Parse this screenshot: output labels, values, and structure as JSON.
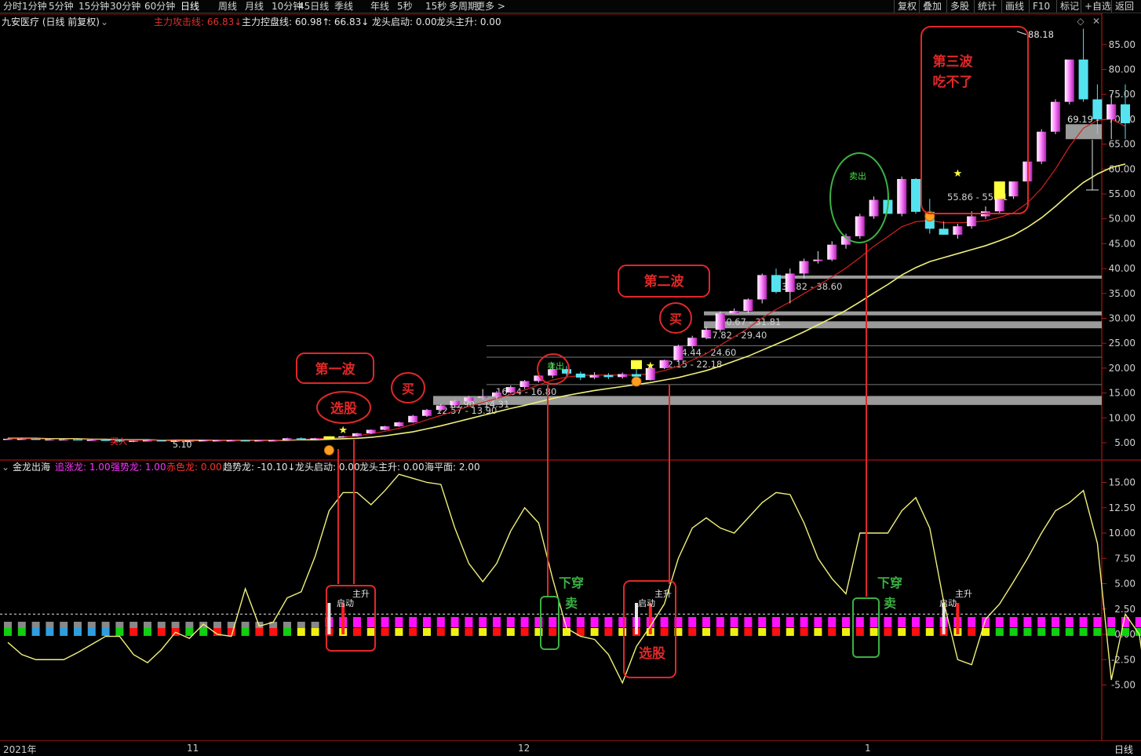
{
  "toolbar": {
    "left": [
      "分时",
      "1分钟",
      "5分钟",
      "15分钟",
      "30分钟",
      "60分钟",
      "日线",
      "周线",
      "月线",
      "10分钟",
      "45日线",
      "季线",
      "年线",
      "5秒",
      "15秒",
      "多周期",
      "更多 >"
    ],
    "active_index": 6,
    "right": [
      "复权",
      "叠加",
      "多股",
      "统计",
      "画线",
      "F10",
      "标记",
      "+自选",
      "返回"
    ]
  },
  "main_panel": {
    "stock": "九安医疗 (日线 前复权)",
    "legend": [
      {
        "text": "主力攻击线: 66.83↓",
        "color": "#e03030"
      },
      {
        "text": "主力控盘线: 60.98↑",
        "color": "#e6e6e6"
      },
      {
        "text": ": 66.83↓",
        "color": "#e6e6e6"
      },
      {
        "text": "龙头启动: 0.00",
        "color": "#e6e6e6"
      },
      {
        "text": "龙头主升: 0.00",
        "color": "#e6e6e6"
      }
    ],
    "y_ticks": [
      "85.00",
      "80.00",
      "75.00",
      "70.00",
      "65.00",
      "60.00",
      "55.00",
      "50.00",
      "45.00",
      "40.00",
      "35.00",
      "30.00",
      "25.00",
      "20.00",
      "15.00",
      "10.00",
      "5.00"
    ],
    "high_marker": "88.18",
    "last_price": "69.19",
    "low_marker": "5.10",
    "band_labels": [
      "12.57 - 13.90",
      "13.90 - 14.31",
      "16.54 - 16.80",
      "22.15 - 22.18",
      "24.44 - 24.60",
      "27.82 - 29.40",
      "30.67 - 31.81",
      "37.82 - 38.60",
      "55.86 - 55.91"
    ],
    "signal_labels": [
      "买入",
      "卖出",
      "卖出"
    ]
  },
  "indicator_panel": {
    "name": "金龙出海",
    "legend": [
      {
        "text": "追涨龙: 1.00",
        "color": "#ff33ff"
      },
      {
        "text": "强势龙: 1.00",
        "color": "#ff33ff"
      },
      {
        "text": "赤色龙: 0.00",
        "color": "#ff3030"
      },
      {
        "text": "趋势龙: -10.10↓",
        "color": "#e6e6e6"
      },
      {
        "text": "龙头启动: 0.00",
        "color": "#e6e6e6"
      },
      {
        "text": "龙头主升: 0.00",
        "color": "#e6e6e6"
      },
      {
        "text": "海平面: 2.00",
        "color": "#e6e6e6"
      }
    ],
    "y_ticks": [
      "15.00",
      "12.50",
      "10.00",
      "7.50",
      "5.00",
      "2.50",
      "0.00",
      "-2.50",
      "-5.00"
    ],
    "bar_labels": [
      "启动",
      "主升",
      "启动",
      "主升",
      "启动",
      "主升"
    ]
  },
  "x_axis": {
    "labels": [
      "2021年",
      "11",
      "12",
      "1"
    ],
    "period": "日线"
  },
  "annotations": {
    "wave1": "第一波",
    "select": "选股",
    "buy": "买",
    "wave2": "第二波",
    "wave3_l1": "第三波",
    "wave3_l2": "吃不了",
    "cross_down_l1": "下穿",
    "cross_down_l2": "卖"
  },
  "colors": {
    "up": "#ff66ff",
    "down": "#55e3f0",
    "ma_attack": "#d42020",
    "ma_control": "#f0f07a",
    "frame": "#8a1010",
    "annot": "#e02828",
    "annot_green": "#3cb043",
    "signal_yellow": "#ffff30"
  },
  "chart_data": {
    "type": "candlestick",
    "price_axis": {
      "min": 5,
      "max": 85,
      "step": 5
    },
    "indicator_axis": {
      "min": -5,
      "max": 15,
      "step": 2.5
    },
    "ohlc": [
      [
        5.8,
        5.9,
        5.7,
        5.8
      ],
      [
        5.8,
        5.9,
        5.7,
        5.8
      ],
      [
        5.8,
        5.9,
        5.6,
        5.7
      ],
      [
        5.7,
        5.8,
        5.6,
        5.7
      ],
      [
        5.7,
        5.8,
        5.6,
        5.7
      ],
      [
        5.7,
        5.8,
        5.5,
        5.6
      ],
      [
        5.6,
        5.7,
        5.5,
        5.6
      ],
      [
        5.6,
        5.7,
        5.4,
        5.5
      ],
      [
        5.5,
        5.6,
        5.1,
        5.3
      ],
      [
        5.3,
        5.5,
        5.1,
        5.4
      ],
      [
        5.4,
        5.6,
        5.3,
        5.5
      ],
      [
        5.5,
        5.6,
        5.3,
        5.4
      ],
      [
        5.4,
        5.5,
        5.3,
        5.4
      ],
      [
        5.4,
        5.5,
        5.3,
        5.4
      ],
      [
        5.4,
        5.5,
        5.3,
        5.5
      ],
      [
        5.5,
        5.6,
        5.4,
        5.5
      ],
      [
        5.5,
        5.6,
        5.4,
        5.5
      ],
      [
        5.5,
        5.6,
        5.3,
        5.4
      ],
      [
        5.4,
        5.5,
        5.3,
        5.5
      ],
      [
        5.5,
        5.6,
        5.4,
        5.5
      ],
      [
        5.5,
        6.0,
        5.4,
        5.9
      ],
      [
        5.9,
        6.1,
        5.7,
        5.8
      ],
      [
        5.8,
        6.0,
        5.7,
        5.9
      ],
      [
        5.9,
        6.3,
        5.8,
        6.2
      ],
      [
        6.2,
        6.4,
        6.0,
        6.3
      ],
      [
        6.3,
        7.0,
        6.2,
        6.9
      ],
      [
        6.9,
        7.7,
        6.8,
        7.6
      ],
      [
        7.6,
        8.4,
        7.5,
        8.3
      ],
      [
        8.3,
        9.2,
        8.2,
        9.1
      ],
      [
        9.1,
        10.6,
        9.0,
        10.4
      ],
      [
        10.4,
        11.8,
        10.2,
        11.6
      ],
      [
        11.6,
        12.8,
        11.3,
        12.5
      ],
      [
        12.5,
        13.6,
        12.0,
        13.4
      ],
      [
        13.4,
        14.4,
        13.0,
        14.1
      ],
      [
        14.1,
        15.8,
        13.7,
        14.3
      ],
      [
        14.3,
        15.4,
        13.8,
        15.1
      ],
      [
        15.1,
        16.5,
        14.9,
        16.2
      ],
      [
        16.2,
        17.6,
        15.8,
        17.4
      ],
      [
        17.4,
        18.7,
        17.1,
        18.5
      ],
      [
        18.5,
        21.0,
        18.0,
        19.8
      ],
      [
        19.8,
        20.4,
        18.4,
        18.9
      ],
      [
        18.9,
        19.3,
        17.6,
        18.1
      ],
      [
        18.1,
        19.2,
        17.8,
        18.6
      ],
      [
        18.6,
        19.0,
        17.8,
        18.2
      ],
      [
        18.2,
        19.1,
        17.9,
        18.8
      ],
      [
        18.8,
        20.1,
        18.3,
        18.3
      ],
      [
        17.6,
        20.2,
        17.5,
        20.0
      ],
      [
        20.0,
        21.7,
        19.8,
        21.6
      ],
      [
        21.6,
        24.7,
        21.3,
        24.4
      ],
      [
        24.4,
        26.5,
        23.9,
        26.1
      ],
      [
        26.1,
        28.3,
        25.8,
        27.7
      ],
      [
        27.7,
        31.4,
        27.2,
        31.0
      ],
      [
        31.0,
        32.0,
        31.0,
        31.5
      ],
      [
        31.5,
        34.0,
        31.0,
        33.8
      ],
      [
        33.8,
        39.0,
        33.0,
        38.7
      ],
      [
        38.7,
        40.0,
        35.0,
        35.3
      ],
      [
        35.3,
        40.0,
        33.0,
        39.0
      ],
      [
        39.0,
        42.0,
        38.0,
        41.5
      ],
      [
        41.5,
        43.5,
        41.0,
        41.8
      ],
      [
        41.8,
        45.5,
        41.5,
        44.8
      ],
      [
        44.8,
        47.0,
        44.0,
        46.5
      ],
      [
        46.5,
        51.0,
        46.0,
        50.5
      ],
      [
        50.5,
        54.5,
        50.0,
        53.8
      ],
      [
        53.8,
        56.0,
        51.5,
        51.0
      ],
      [
        51.0,
        58.5,
        50.5,
        58.0
      ],
      [
        58.0,
        58.2,
        51.0,
        51.4
      ],
      [
        51.4,
        54.0,
        47.0,
        48.0
      ],
      [
        48.0,
        49.5,
        47.0,
        46.8
      ],
      [
        46.8,
        49.0,
        46.0,
        48.5
      ],
      [
        48.5,
        51.5,
        48.0,
        50.5
      ],
      [
        50.5,
        52.5,
        50.0,
        51.5
      ],
      [
        51.5,
        55.0,
        51.0,
        54.5
      ],
      [
        54.5,
        57.0,
        54.0,
        57.5
      ],
      [
        57.5,
        62.0,
        57.0,
        61.5
      ],
      [
        61.5,
        68.0,
        61.0,
        67.5
      ],
      [
        67.5,
        74.0,
        67.0,
        73.5
      ],
      [
        73.5,
        79.0,
        73.0,
        82.0
      ],
      [
        82.0,
        88.2,
        73.5,
        74.0
      ],
      [
        74.0,
        77.0,
        67.0,
        70.0
      ],
      [
        70.0,
        75.0,
        66.0,
        73.0
      ],
      [
        73.0,
        77.0,
        66.0,
        69.2
      ]
    ],
    "ma_attack": [
      5.8,
      5.8,
      5.8,
      5.7,
      5.7,
      5.7,
      5.6,
      5.6,
      5.5,
      5.5,
      5.5,
      5.5,
      5.4,
      5.4,
      5.4,
      5.5,
      5.5,
      5.5,
      5.5,
      5.5,
      5.6,
      5.7,
      5.8,
      5.9,
      6.1,
      6.4,
      6.8,
      7.3,
      7.9,
      8.7,
      9.6,
      10.5,
      11.4,
      12.3,
      13.1,
      13.9,
      14.7,
      15.6,
      16.6,
      17.6,
      18.2,
      18.5,
      18.6,
      18.6,
      18.6,
      18.6,
      18.9,
      19.5,
      20.4,
      21.6,
      22.9,
      24.6,
      26.3,
      28.0,
      30.1,
      31.8,
      33.3,
      35.0,
      36.6,
      38.3,
      40.1,
      42.2,
      44.5,
      46.4,
      48.4,
      49.4,
      49.7,
      49.2,
      49.2,
      49.3,
      49.6,
      50.3,
      51.2,
      53.2,
      56.1,
      60.0,
      64.5,
      68.2,
      69.8,
      70.0,
      68.6
    ],
    "ma_control": [
      5.9,
      5.9,
      5.9,
      5.8,
      5.8,
      5.8,
      5.7,
      5.7,
      5.6,
      5.6,
      5.6,
      5.5,
      5.5,
      5.5,
      5.5,
      5.5,
      5.5,
      5.5,
      5.5,
      5.5,
      5.5,
      5.6,
      5.6,
      5.7,
      5.8,
      5.9,
      6.1,
      6.4,
      6.8,
      7.2,
      7.8,
      8.4,
      9.1,
      9.8,
      10.5,
      11.2,
      11.9,
      12.5,
      13.2,
      13.9,
      14.5,
      15.0,
      15.5,
      15.9,
      16.3,
      16.7,
      17.1,
      17.6,
      18.1,
      18.8,
      19.5,
      20.4,
      21.4,
      22.4,
      23.6,
      24.8,
      26.0,
      27.3,
      28.7,
      30.1,
      31.6,
      33.3,
      35.1,
      36.8,
      38.7,
      40.2,
      41.4,
      42.2,
      43.0,
      43.8,
      44.6,
      45.6,
      46.7,
      48.3,
      50.2,
      52.5,
      55.0,
      57.3,
      59.0,
      60.3,
      61.0
    ],
    "indicator_line": [
      -0.8,
      -2.0,
      -2.5,
      -2.5,
      -2.5,
      -1.8,
      -1.0,
      -0.2,
      -0.2,
      -2.0,
      -2.8,
      -1.5,
      0.2,
      -0.4,
      1.0,
      0.0,
      -0.2,
      4.5,
      0.8,
      1.2,
      3.6,
      4.2,
      7.7,
      12.2,
      14.0,
      14.0,
      12.8,
      14.2,
      15.8,
      15.4,
      15.0,
      14.8,
      10.5,
      7.0,
      5.2,
      7.0,
      10.2,
      12.5,
      11.0,
      5.5,
      0.6,
      -0.2,
      -0.5,
      -2.0,
      -4.8,
      -1.2,
      0.8,
      3.0,
      7.5,
      10.5,
      11.5,
      10.5,
      10.0,
      11.5,
      13.0,
      14.0,
      13.8,
      11.0,
      7.5,
      5.5,
      4.0,
      10.0,
      10.0,
      10.0,
      12.2,
      13.5,
      10.5,
      3.2,
      -2.5,
      -3.0,
      1.5,
      3.0,
      5.2,
      7.5,
      10.0,
      12.2,
      13.0,
      14.2,
      9.0,
      -4.5,
      2.0,
      0.0,
      -9.5,
      -10.1
    ],
    "signal_bars": [
      "G",
      "G",
      "B",
      "B",
      "B",
      "B",
      "B",
      "B",
      "G",
      "R",
      "G",
      "R",
      "R",
      "G",
      "G",
      "R",
      "R",
      "G",
      "R",
      "R",
      "G",
      "Y",
      "Y",
      "R",
      "R",
      "R",
      "R",
      "Y",
      "Y",
      "Y",
      "Y",
      "Y",
      "Y",
      "R",
      "R",
      "R",
      "R",
      "R",
      "R",
      "R",
      "Y",
      "R",
      "G",
      "G",
      "B",
      "G",
      "G",
      "R",
      "Y",
      "R",
      "Y",
      "R",
      "Y",
      "R",
      "Y",
      "R",
      "R",
      "R",
      "R",
      "R",
      "R",
      "R",
      "R",
      "R",
      "R",
      "Y",
      "R",
      "G",
      "G",
      "G",
      "G",
      "Y",
      "G",
      "G",
      "G",
      "G",
      "G",
      "G",
      "G",
      "G",
      "G",
      "G",
      "G",
      "G"
    ]
  }
}
